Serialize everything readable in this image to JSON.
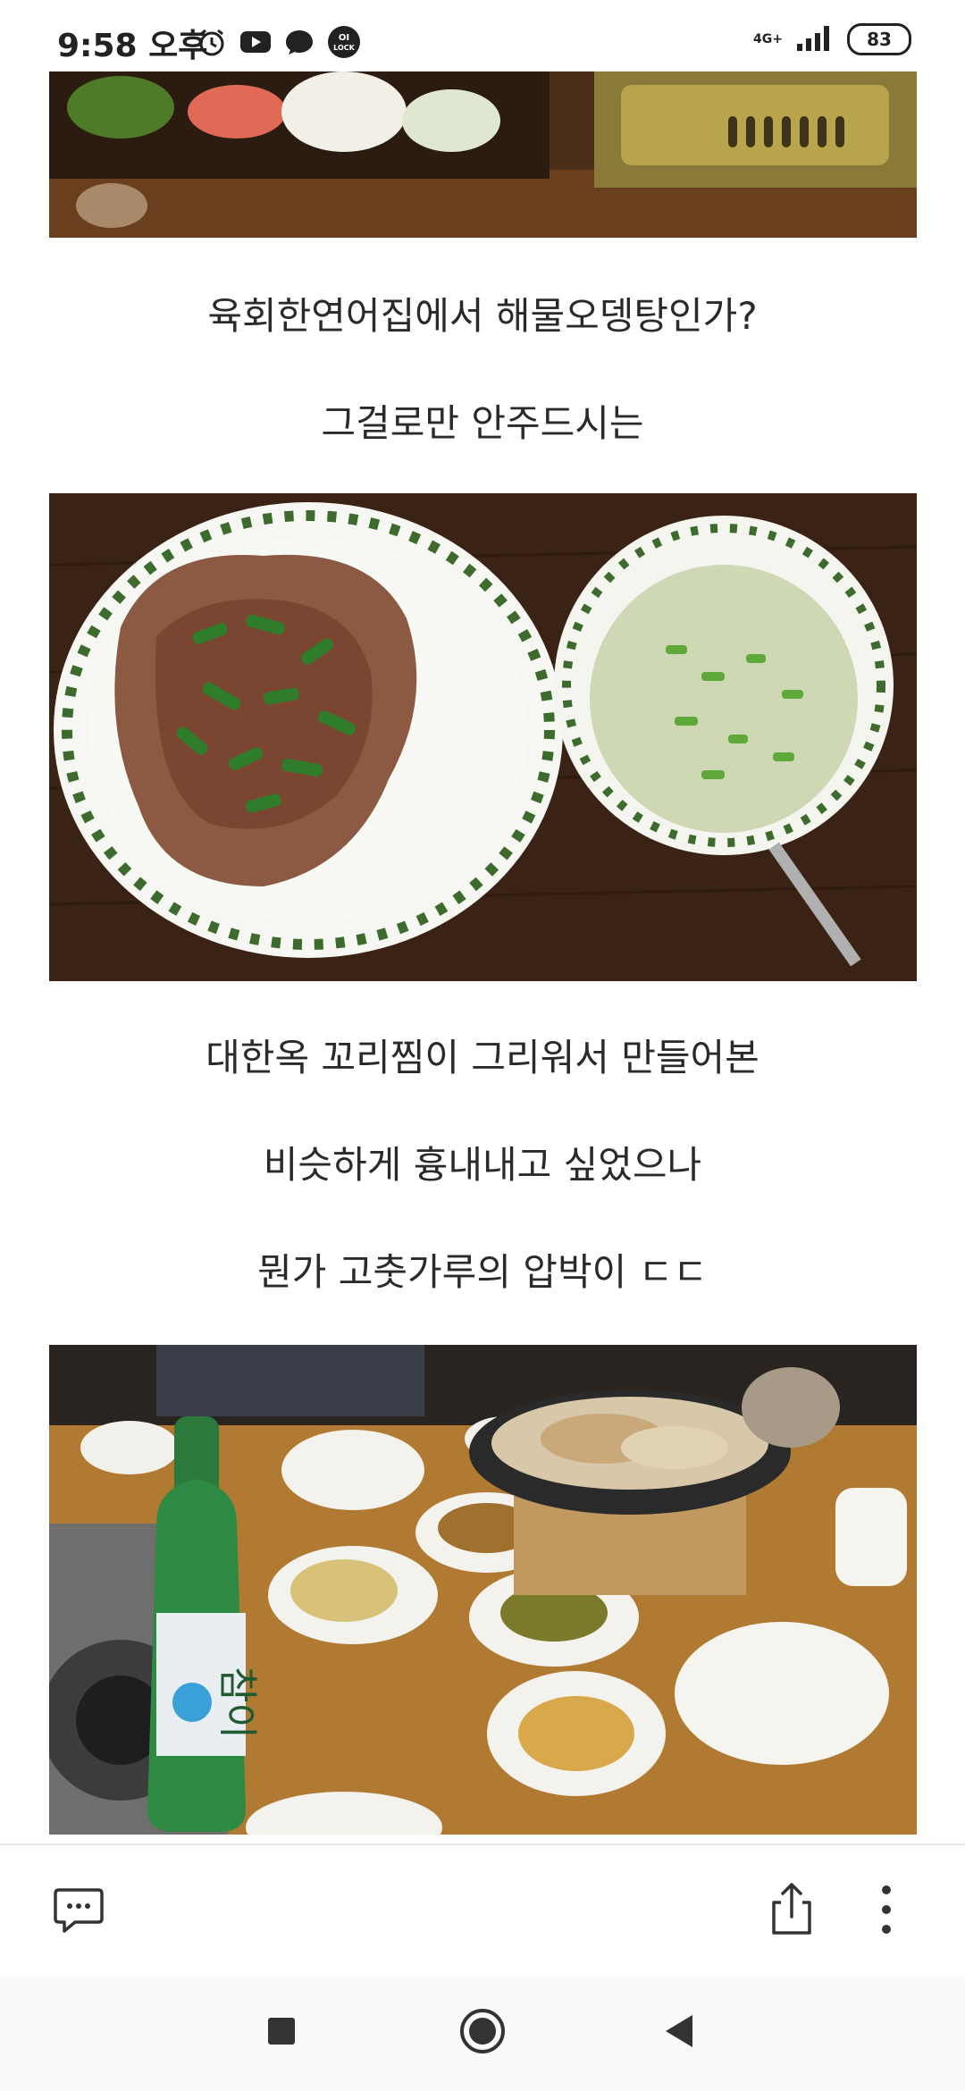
{
  "status_bar": {
    "time": "9:58 오후",
    "network": "4G+",
    "battery": "83",
    "icons": [
      "alarm-icon",
      "youtube-icon",
      "chat-icon",
      "oi-lock-icon"
    ],
    "oi_lock_line1": "OI",
    "oi_lock_line2": "LOCK"
  },
  "captions": {
    "c1": "육회한연어집에서 해물오뎅탕인가?",
    "c2": "그걸로만 안주드시는",
    "c3": "대한옥 꼬리찜이 그리워서 만들어본",
    "c4": "비슷하게 흉내내고 싶었으나",
    "c5": "뭔가 고춧가루의 압박이 ㄷㄷ"
  },
  "photos": {
    "top": "food-photo-sashimi-grill",
    "middle": "food-photo-oxtail-and-soup",
    "bottom": "food-photo-table-soju"
  },
  "bottle_label": "참이",
  "toolbar": {
    "comment_icon": "comment-icon",
    "share_icon": "share-icon",
    "more_icon": "more-vertical-icon"
  },
  "navbar": {
    "recent": "recent-apps-icon",
    "home": "home-icon",
    "back": "back-icon"
  }
}
